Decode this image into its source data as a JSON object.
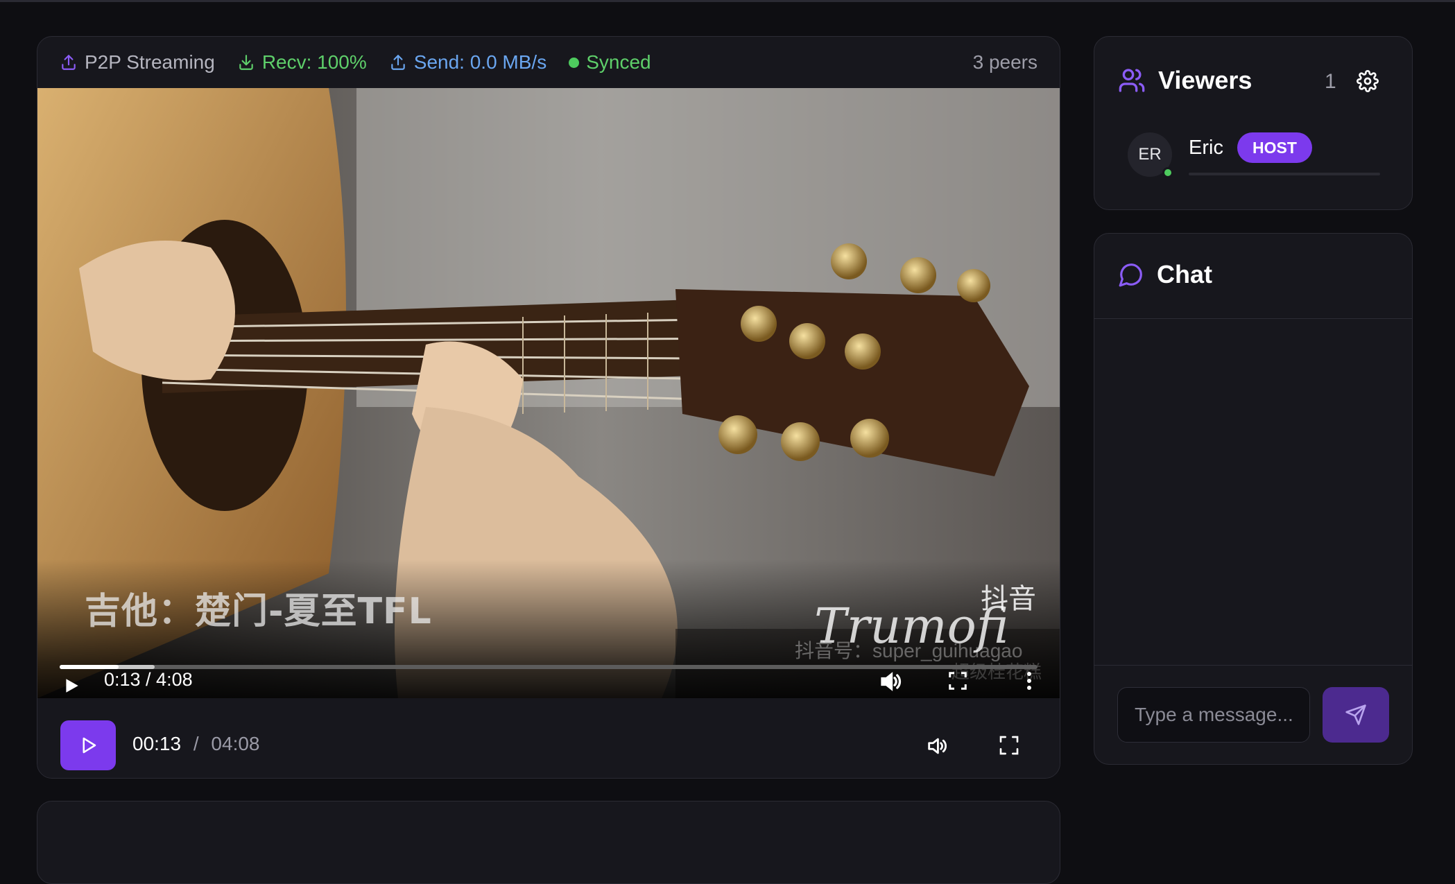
{
  "stats": {
    "p2p_label": "P2P Streaming",
    "recv_label": "Recv: 100%",
    "send_label": "Send: 0.0 MB/s",
    "sync_label": "Synced",
    "peers_label": "3 peers"
  },
  "video": {
    "overlay_title": "吉他：楚门-夏至TFL",
    "watermark_logo": "Trumofi",
    "watermark_brand": "抖音",
    "watermark_id": "抖音号：super_guihuagao",
    "watermark_search": "超级桂花糕",
    "native_time": "0:13 / 4:08",
    "native_played_fraction": 0.06,
    "native_buffered_fraction": 0.097
  },
  "controls": {
    "current_time": "00:13",
    "separator": "/",
    "duration": "04:08",
    "progress_fraction": 0.052
  },
  "viewers": {
    "title": "Viewers",
    "count": "1",
    "list": [
      {
        "initials": "ER",
        "name": "Eric",
        "badge": "HOST",
        "online": true
      }
    ]
  },
  "chat": {
    "title": "Chat",
    "input_placeholder": "Type a message..."
  },
  "colors": {
    "accent": "#7c3aed",
    "success": "#5ecf6a",
    "info": "#6aa6f0",
    "background": "#0e0e12",
    "card": "#17171d"
  },
  "icons": {
    "p2p": "upload-icon",
    "recv": "download-icon",
    "send": "upload-icon",
    "viewers": "users-icon",
    "settings": "gear-icon",
    "chat": "message-circle-icon",
    "send_button": "send-icon"
  }
}
